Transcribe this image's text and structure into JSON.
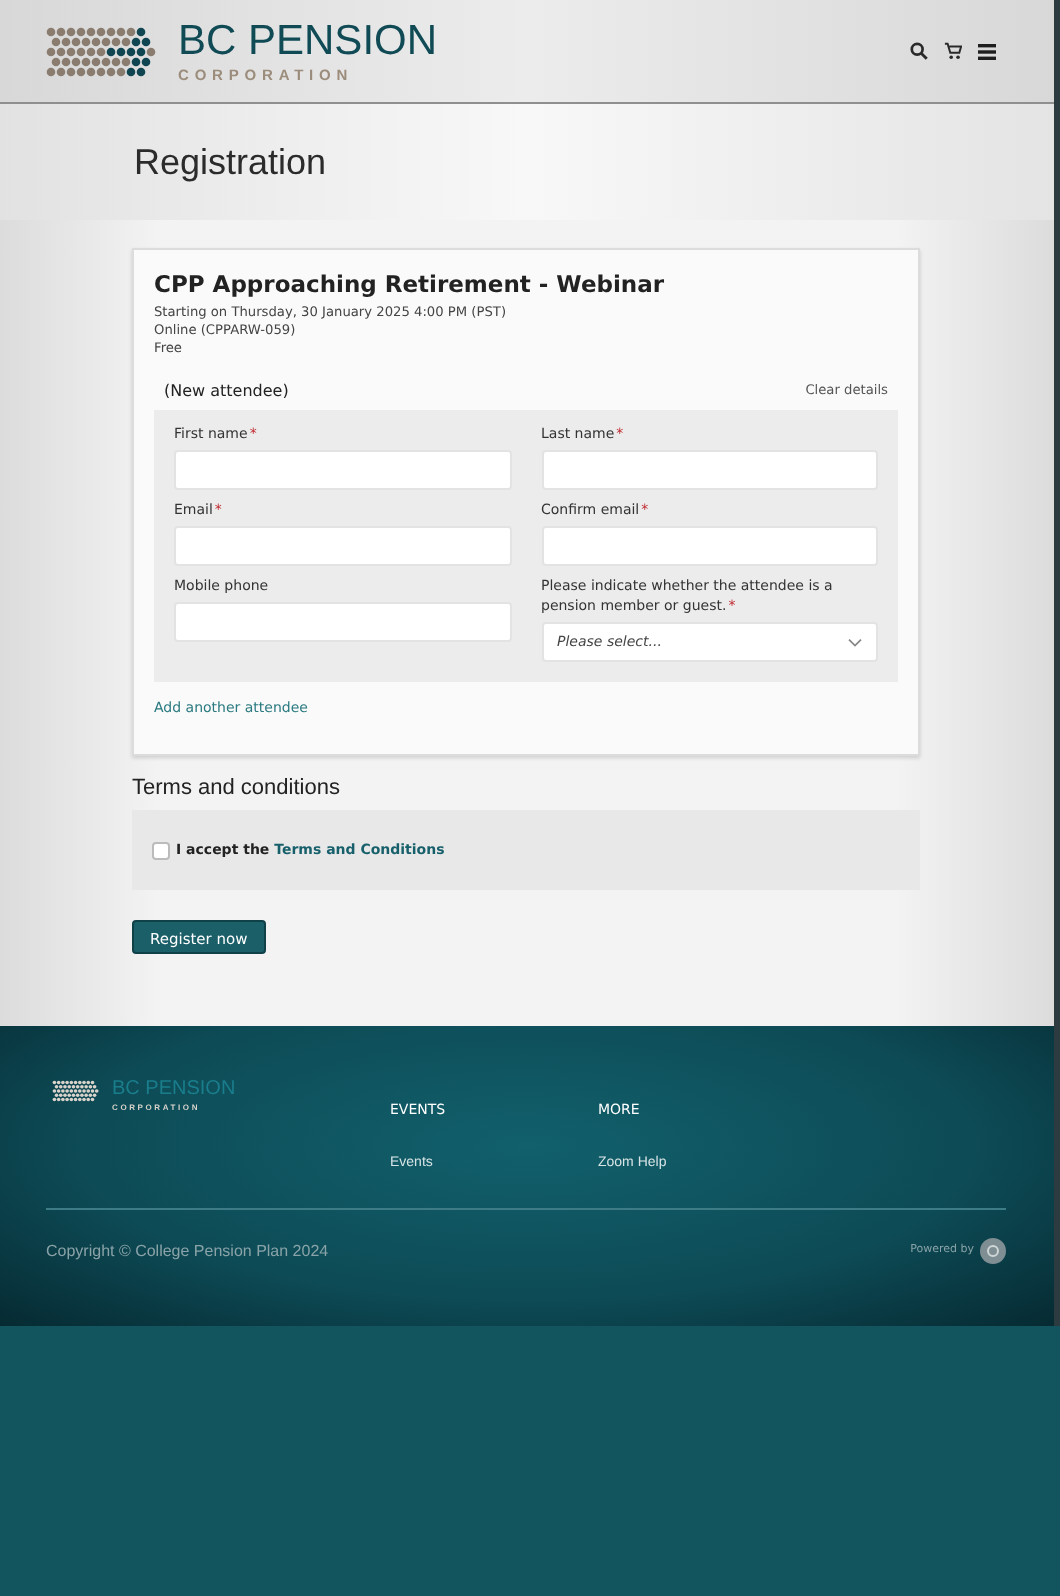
{
  "header": {
    "logo": {
      "name": "BC PENSION",
      "subtitle": "CORPORATION"
    }
  },
  "page_title": "Registration",
  "event": {
    "title": "CPP Approaching Retirement - Webinar",
    "details": [
      "Starting on Thursday, 30 January 2025 4:00 PM (PST)",
      "Online (CPPARW-059)",
      "Free"
    ]
  },
  "attendee": {
    "heading": "(New attendee)",
    "clear": "Clear details",
    "fields": [
      {
        "kind": "text",
        "label": "First name",
        "required_mark": "*"
      },
      {
        "kind": "text",
        "label": "Last name",
        "required_mark": "*"
      },
      {
        "kind": "text",
        "label": "Email",
        "required_mark": "*"
      },
      {
        "kind": "text",
        "label": "Confirm email",
        "required_mark": "*"
      },
      {
        "kind": "text",
        "label": "Mobile phone"
      },
      {
        "kind": "select",
        "label": "Please indicate whether the attendee is a pension member or guest.",
        "required_mark": "*",
        "placeholder": "Please select..."
      }
    ]
  },
  "add_attendee": "Add another attendee",
  "terms": {
    "heading": "Terms and conditions",
    "checked": false,
    "text": "I accept the ",
    "link": "Terms and Conditions"
  },
  "submit": "Register now",
  "footer": {
    "logo": {
      "name": "BC PENSION",
      "subtitle": "CORPORATION"
    },
    "columns": [
      {
        "heading": "EVENTS",
        "links": [
          "Events"
        ]
      },
      {
        "heading": "MORE",
        "links": [
          "Zoom Help"
        ]
      }
    ],
    "copyright": "Copyright © College Pension Plan 2024",
    "powered": "Powered by"
  }
}
